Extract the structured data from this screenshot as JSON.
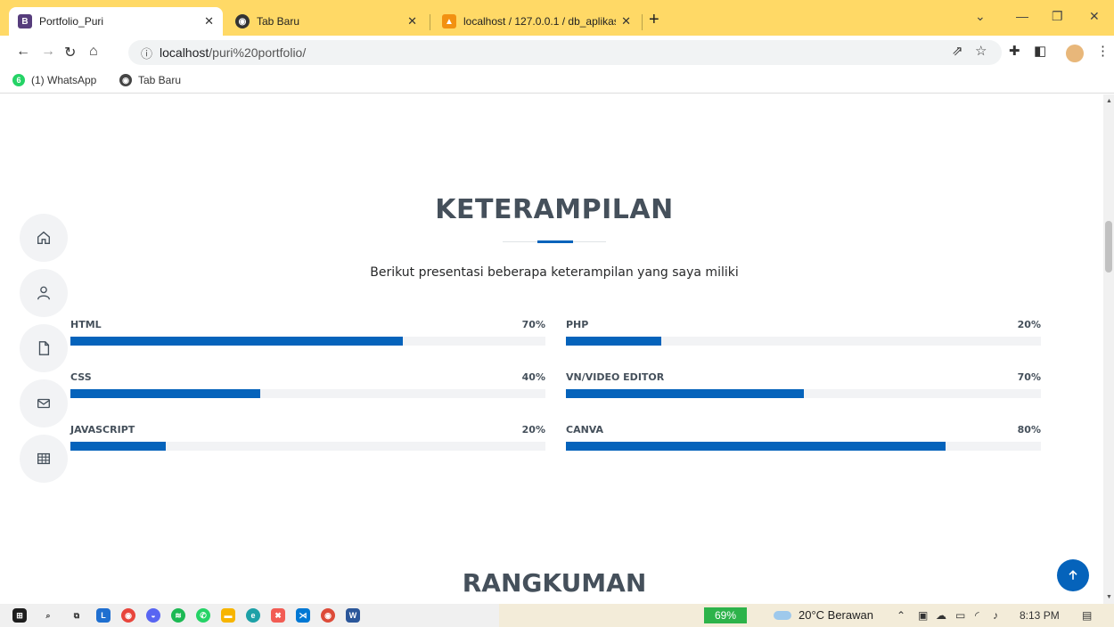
{
  "browser": {
    "tabs": [
      {
        "label": "Portfolio_Puri",
        "active": true
      },
      {
        "label": "Tab Baru",
        "active": false
      },
      {
        "label": "localhost / 127.0.0.1 / db_aplikas",
        "active": false
      }
    ],
    "url_host": "localhost",
    "url_path": "/puri%20portfolio/",
    "bookmarks": [
      "(1) WhatsApp",
      "Tab Baru"
    ],
    "whatsapp_badge": "6"
  },
  "skills": {
    "title": "KETERAMPILAN",
    "subtitle": "Berikut presentasi beberapa keterampilan yang saya miliki",
    "left": [
      {
        "name": "HTML",
        "label": "70%",
        "level": 70
      },
      {
        "name": "CSS",
        "label": "40%",
        "level": 40
      },
      {
        "name": "JAVASCRIPT",
        "label": "20%",
        "level": 20
      }
    ],
    "right": [
      {
        "name": "PHP",
        "label": "20%",
        "level": 20
      },
      {
        "name": "VN/VIDEO EDITOR",
        "label": "70%",
        "level": 50
      },
      {
        "name": "CANVA",
        "label": "80%",
        "level": 80
      }
    ]
  },
  "next_section": {
    "title": "RANGKUMAN"
  },
  "side_nav": [
    "home-icon",
    "person-icon",
    "file-icon",
    "envelope-icon",
    "table-icon"
  ],
  "taskbar": {
    "battery": "69%",
    "weather": "20°C  Berawan",
    "time": "8:13 PM"
  },
  "colors": {
    "accent": "#0563bb",
    "heading": "#45505b",
    "chrome": "#ffd966"
  }
}
